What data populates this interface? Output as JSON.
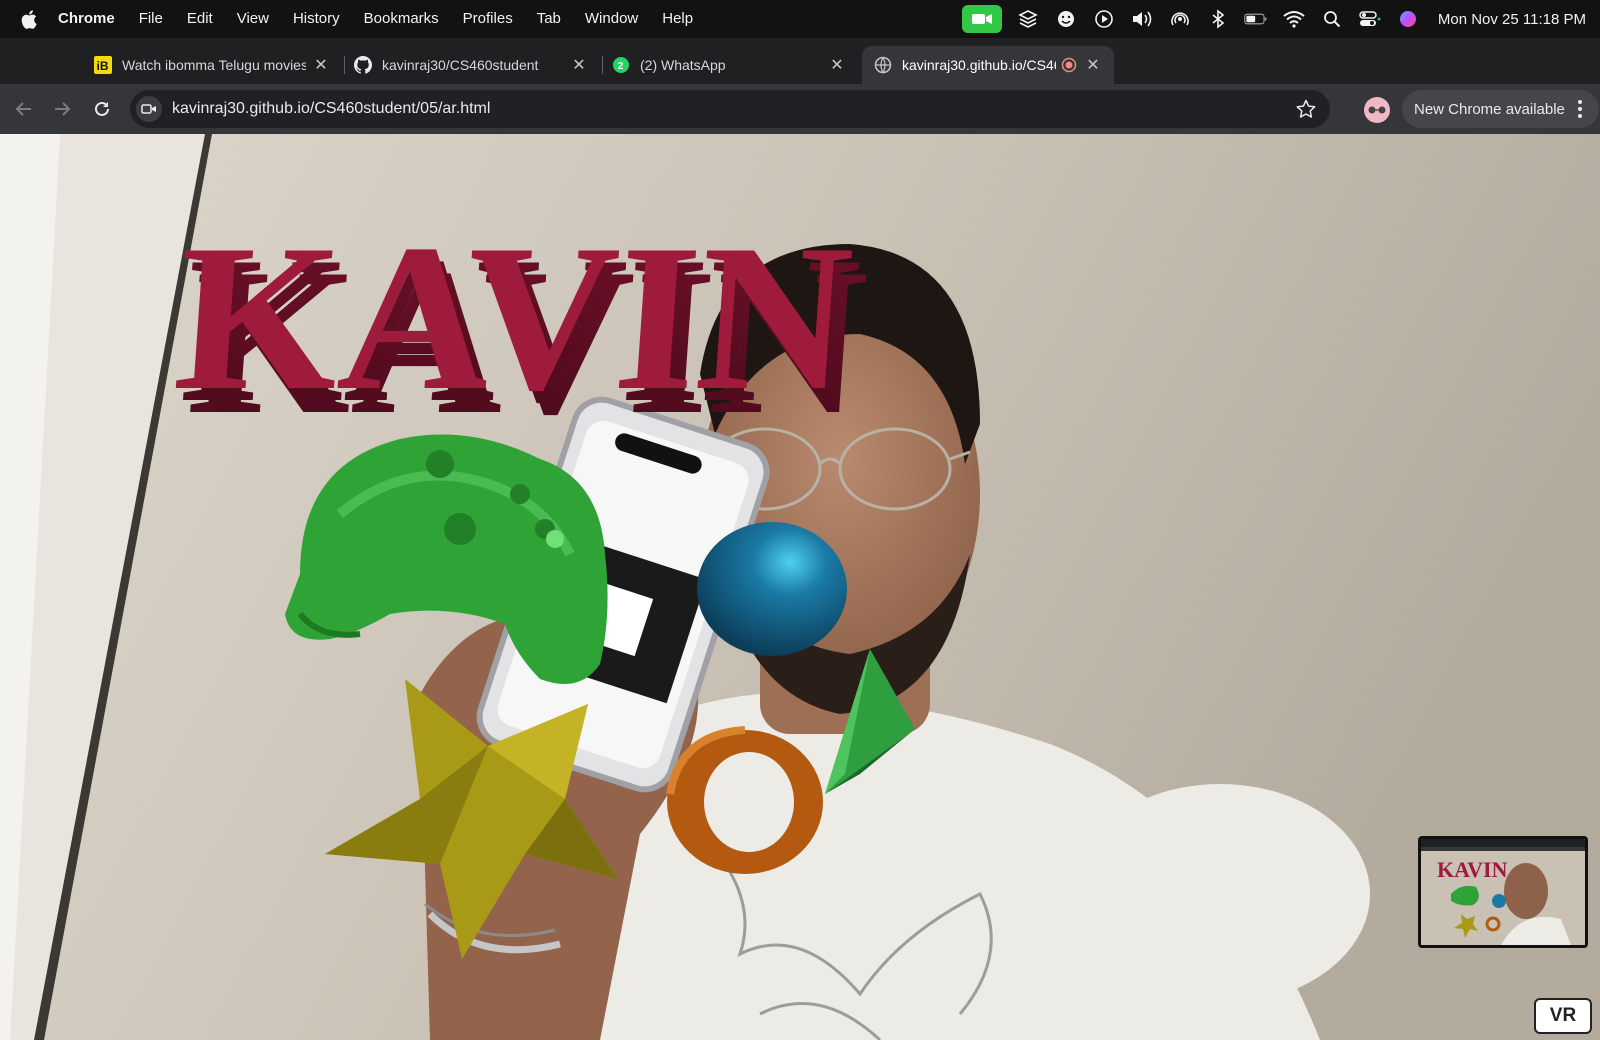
{
  "menubar": {
    "app_name": "Chrome",
    "items": [
      "File",
      "Edit",
      "View",
      "History",
      "Bookmarks",
      "Profiles",
      "Tab",
      "Window",
      "Help"
    ],
    "status_icons": [
      "facetime-icon",
      "layers-icon",
      "emoji-icon",
      "play-icon",
      "volume-icon",
      "airdrop-icon",
      "bluetooth-icon",
      "battery-icon",
      "wifi-icon",
      "spotlight-icon",
      "control-center-icon",
      "siri-icon"
    ],
    "clock": "Mon Nov 25  11:18 PM"
  },
  "tabs": [
    {
      "title": "Watch ibomma Telugu movies",
      "favicon": "ibomma-icon",
      "active": false
    },
    {
      "title": "kavinraj30/CS460student",
      "favicon": "github-icon",
      "active": false
    },
    {
      "title": "(2) WhatsApp",
      "favicon": "whatsapp-icon",
      "badge": "2",
      "active": false
    },
    {
      "title": "kavinraj30.github.io/CS46",
      "favicon": "globe-icon",
      "active": true,
      "recording": true
    }
  ],
  "toolbar": {
    "url": "kavinraj30.github.io/CS460student/05/ar.html",
    "update_label": "New Chrome available"
  },
  "scene": {
    "text3d": "KAVIN",
    "objects": [
      "kavin-3d-text",
      "green-game-controller-model",
      "blue-sphere",
      "gold-star",
      "orange-torus",
      "green-cone"
    ],
    "colors": {
      "text": "#9e1b3c",
      "controller": "#2fa336",
      "sphere": "#1a7aa6",
      "star": "#a89a16",
      "torus": "#b35a10",
      "cone": "#2e9e3e",
      "wall": "#c7bfb3",
      "shirt": "#ecebe6"
    }
  },
  "vr_button": "VR",
  "accent": {
    "facetime": "#33c748",
    "record": "#f28b82"
  }
}
